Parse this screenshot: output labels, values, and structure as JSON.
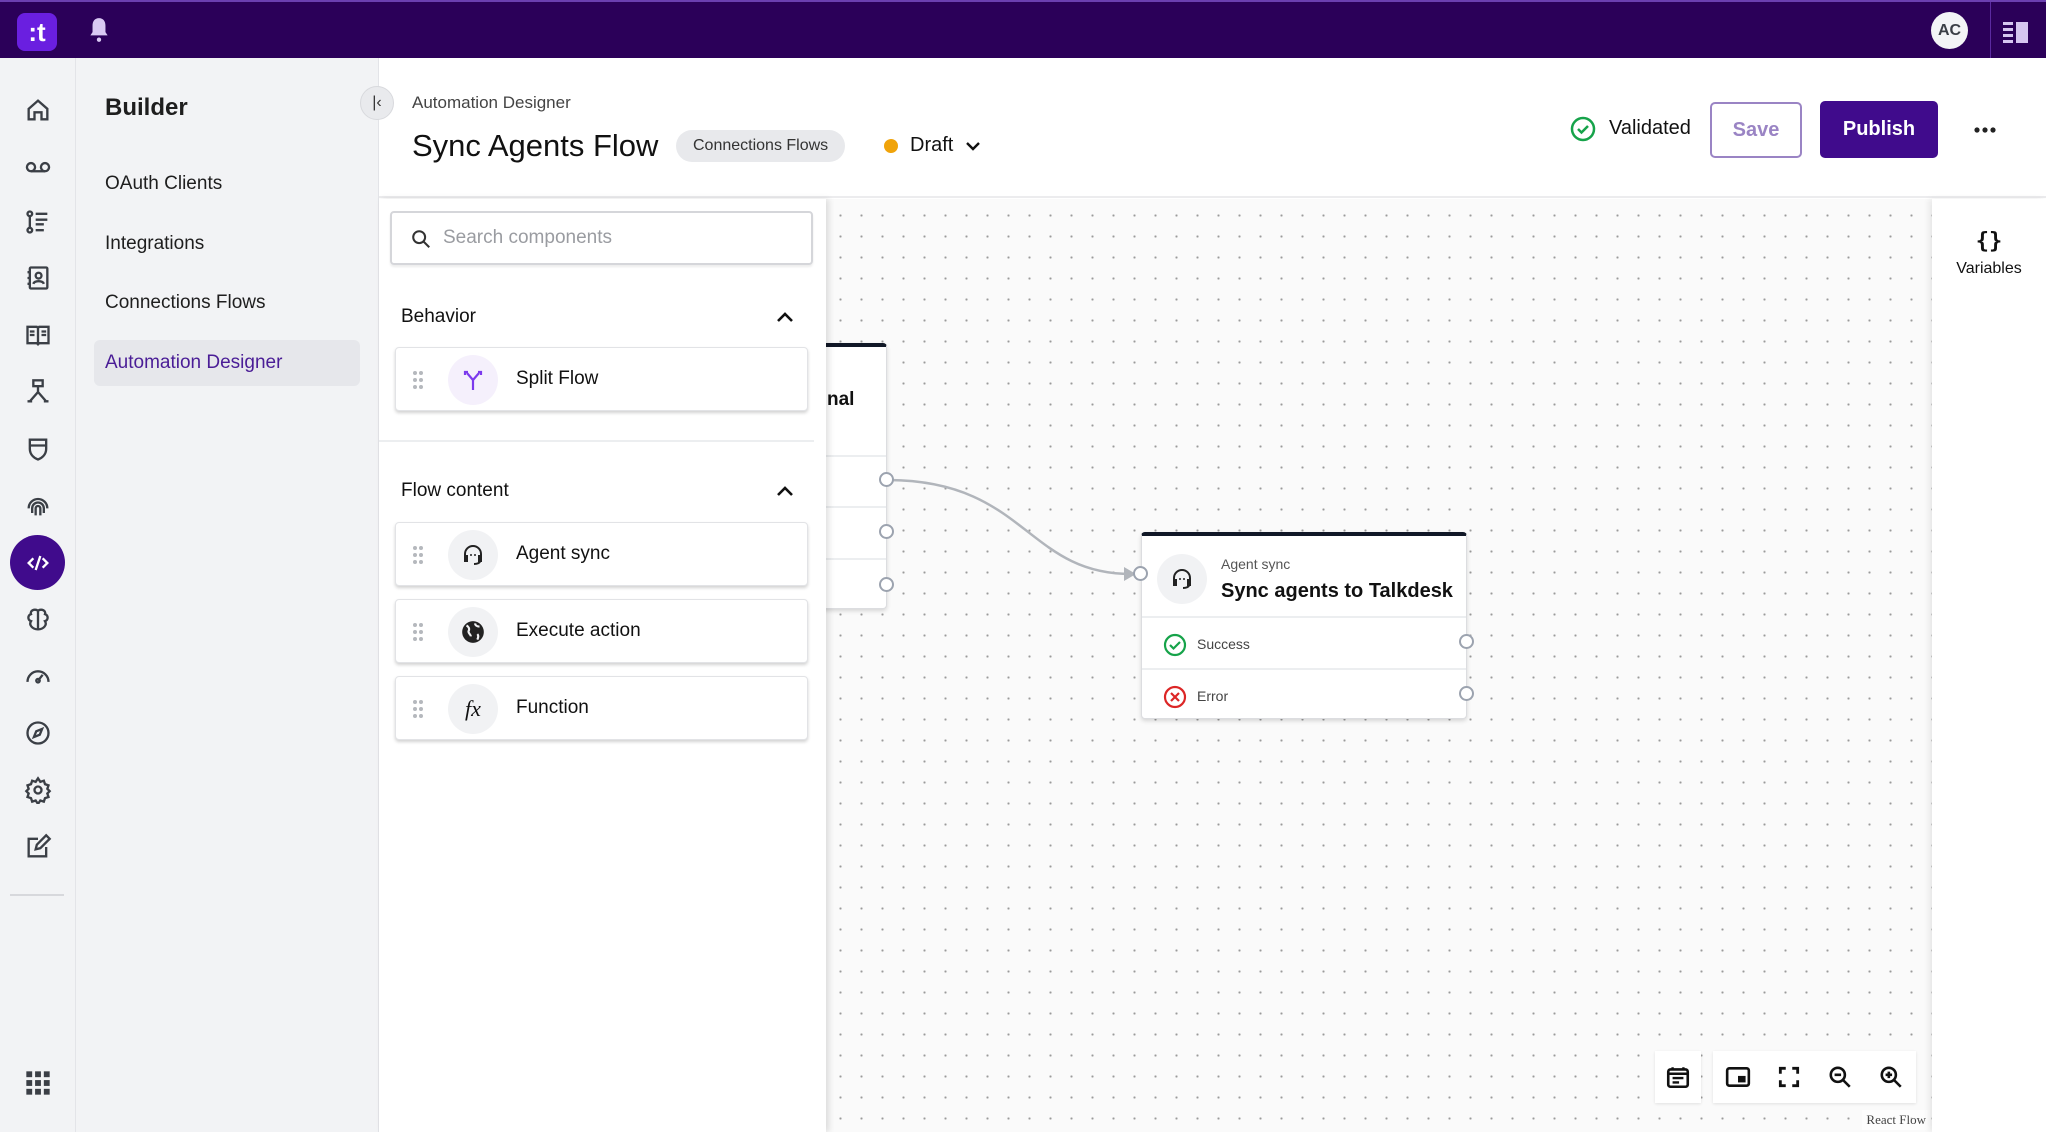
{
  "topbar": {
    "logo": ":t",
    "avatar_initials": "AC",
    "icons": [
      "bell-icon",
      "panel-toggle-icon"
    ],
    "color": "#2b0059"
  },
  "rail": {
    "icons": [
      "home-icon",
      "voicemail-icon",
      "list-icon",
      "contacts-icon",
      "book-icon",
      "workflow-icon",
      "shield-icon",
      "fingerprint-icon",
      "code-icon",
      "brain-icon",
      "gauge-icon",
      "compass-icon",
      "gear-icon",
      "edit-icon",
      "apps-grid-icon"
    ],
    "active": "code-icon",
    "accent": "#400b8c"
  },
  "sidebar": {
    "title": "Builder",
    "items": [
      {
        "label": "OAuth Clients"
      },
      {
        "label": "Integrations"
      },
      {
        "label": "Connections Flows"
      },
      {
        "label": "Automation Designer",
        "active": true
      }
    ]
  },
  "header": {
    "breadcrumb": "Automation Designer",
    "title": "Sync Agents Flow",
    "chip": "Connections Flows",
    "status": "Draft",
    "status_color": "#f0a30a",
    "validation": "Validated",
    "validation_color": "#16a34a",
    "save_label": "Save",
    "publish_label": "Publish"
  },
  "panel": {
    "search_placeholder": "Search components",
    "sections": [
      {
        "title": "Behavior",
        "items": [
          {
            "label": "Split Flow",
            "icon": "split-icon"
          }
        ]
      },
      {
        "title": "Flow content",
        "items": [
          {
            "label": "Agent sync",
            "icon": "headset-icon"
          },
          {
            "label": "Execute action",
            "icon": "globe-icon"
          },
          {
            "label": "Function",
            "icon": "function-icon",
            "glyph": "fx"
          }
        ]
      }
    ]
  },
  "canvas": {
    "left_node_title_fragment": "nal",
    "node": {
      "type": "Agent sync",
      "title": "Sync agents to Talkdesk",
      "outputs": [
        {
          "label": "Success",
          "color": "#16a34a"
        },
        {
          "label": "Error",
          "color": "#dc2626"
        }
      ]
    },
    "attribution": "React Flow"
  },
  "right_panel": {
    "icon_glyph": "{}",
    "label": "Variables"
  }
}
